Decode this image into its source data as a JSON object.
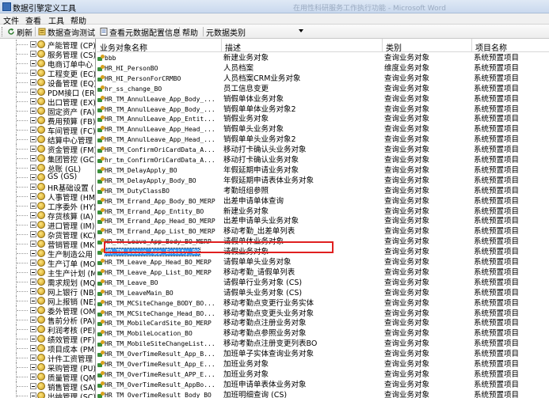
{
  "window": {
    "title": "数据引擎定义工具",
    "ghost_title": "在用性科研服务工作执行功能 - Microsoft Word"
  },
  "menu": [
    "文件",
    "查看",
    "工具",
    "帮助"
  ],
  "toolbar": {
    "refresh": "刷新",
    "query_test": "数据查询测试",
    "view_config": "查看元数据配置信息",
    "help": "帮助",
    "category_label": "元数据类别"
  },
  "tree": {
    "items": [
      "产能管理 (CP)",
      "服务管理 (CS)",
      "电商订单中心",
      "工程变更 (EC)",
      "设备管理 (EQ)",
      "PDM接口 (ER)",
      "出口管理 (EX)",
      "固定资产 (FA)",
      "费用预算 (FB)",
      "车间管理 (FC)",
      "结算中心管理",
      "资金管理 (FM)",
      "集团管控 (GC)",
      "总账 (GL)",
      "GS (GS)",
      "HR基础设置 (",
      "人事管理 (HM)",
      "工序委外 (HY)",
      "存货核算 (IA)",
      "进口管理 (IM)",
      "杂货管理 (KC)",
      "营销管理 (MK)",
      "生产制造公用",
      "生产订单 (MO)",
      "主生产计划 (M",
      "需求规划 (MQ)",
      "网上银行 (NB)",
      "网上报销 (NE)",
      "委外管理 (OM)",
      "售前分析 (PA)",
      "利润考核 (PE)",
      "绩效管理 (PF)",
      "项目成本 (PM)",
      "计件工资管理",
      "采购管理 (PU)",
      "质量管理 (QM)",
      "销售管理 (SA)",
      "出纳管理 (SC)"
    ]
  },
  "list": {
    "columns": [
      "业务对象名称",
      "描述",
      "类别",
      "项目名称"
    ],
    "rows": [
      {
        "name": "bbb",
        "desc": "新建业务对象",
        "cat": "查询业务对象",
        "proj": "系统预置项目"
      },
      {
        "name": "HR_HI_PersonBO",
        "desc": "人员档案",
        "cat": "维度业务对象",
        "proj": "系统预置项目"
      },
      {
        "name": "HR_HI_PersonForCRMBO",
        "desc": "人员档案CRM业务对象",
        "cat": "查询业务对象",
        "proj": "系统预置项目"
      },
      {
        "name": "hr_ss_change_BO",
        "desc": "员工信息变更",
        "cat": "查询业务对象",
        "proj": "系统预置项目"
      },
      {
        "name": "HR_TM_AnnulLeave_App_Body_...",
        "desc": "销假单体业务对象",
        "cat": "查询业务对象",
        "proj": "系统预置项目"
      },
      {
        "name": "HR_TM_AnnulLeave_App_Body_...",
        "desc": "销假单单体业务对象2",
        "cat": "查询业务对象",
        "proj": "系统预置项目"
      },
      {
        "name": "HR_TM_AnnulLeave_App_Entit...",
        "desc": "销假业务对象",
        "cat": "查询业务对象",
        "proj": "系统预置项目"
      },
      {
        "name": "HR_TM_AnnulLeave_App_Head_...",
        "desc": "销假单头业务对象",
        "cat": "查询业务对象",
        "proj": "系统预置项目"
      },
      {
        "name": "HR_TM_AnnulLeave_App_Head_...",
        "desc": "销假单单头业务对象2",
        "cat": "查询业务对象",
        "proj": "系统预置项目"
      },
      {
        "name": "HR_TM_ConfirmOriCardData_A...",
        "desc": "移动打卡确认头业务对象",
        "cat": "查询业务对象",
        "proj": "系统预置项目"
      },
      {
        "name": "hr_tm_ConfirmOriCardData_A...",
        "desc": "移动打卡确认业务对象",
        "cat": "查询业务对象",
        "proj": "系统预置项目"
      },
      {
        "name": "HR_TM_DelayApply_BO",
        "desc": "年假延期申请业务对象",
        "cat": "查询业务对象",
        "proj": "系统预置项目"
      },
      {
        "name": "HR_TM_DelayApply_Body_BO",
        "desc": "年假延期申请表体业务对象",
        "cat": "查询业务对象",
        "proj": "系统预置项目"
      },
      {
        "name": "HR_TM_DutyClassBO",
        "desc": "考勤班组参照",
        "cat": "查询业务对象",
        "proj": "系统预置项目"
      },
      {
        "name": "HR_TM_Errand_App_Body_BO_MERP",
        "desc": "出差申请单体查询",
        "cat": "查询业务对象",
        "proj": "系统预置项目"
      },
      {
        "name": "HR_TM_Errand_App_Entity_BO",
        "desc": "新建业务对象",
        "cat": "查询业务对象",
        "proj": "系统预置项目"
      },
      {
        "name": "HR_TM_Errand_App_Head_BO_MERP",
        "desc": "出差申请单头业务对象",
        "cat": "查询业务对象",
        "proj": "系统预置项目"
      },
      {
        "name": "HR_TM_Errand_App_List_BO_MERP",
        "desc": "移动考勤_出差单列表",
        "cat": "查询业务对象",
        "proj": "系统预置项目"
      },
      {
        "name": "HR_TM_Leave_App_Body_BO_MERP",
        "desc": "请假单体业务对象",
        "cat": "查询业务对象",
        "proj": "系统预置项目"
      },
      {
        "name": "HR_TM_Leave_App_Entity_BO",
        "desc": "请假业务对象",
        "cat": "查询业务对象",
        "proj": "系统预置项目",
        "selected": true
      },
      {
        "name": "HR_TM_Leave_App_Head_BO_MERP",
        "desc": "请假单单头业务对象",
        "cat": "查询业务对象",
        "proj": "系统预置项目"
      },
      {
        "name": "HR_TM_Leave_App_List_BO_MERP",
        "desc": "移动考勤_请假单列表",
        "cat": "查询业务对象",
        "proj": "系统预置项目"
      },
      {
        "name": "HR_TM_Leave_BO",
        "desc": "请假单行业务对象 (CS)",
        "cat": "查询业务对象",
        "proj": "系统预置项目"
      },
      {
        "name": "HR_TM_LeaveMain_BO",
        "desc": "请假单头业务对象 (CS)",
        "cat": "查询业务对象",
        "proj": "系统预置项目"
      },
      {
        "name": "HR_TM_MCSiteChange_BODY_BO...",
        "desc": "移动考勤点变更行业务实体",
        "cat": "查询业务对象",
        "proj": "系统预置项目"
      },
      {
        "name": "HR_TM_MCSiteChange_Head_BO...",
        "desc": "移动考勤点变更头业务对象",
        "cat": "查询业务对象",
        "proj": "系统预置项目"
      },
      {
        "name": "HR_TM_MobileCardSite_BO_MERP",
        "desc": "移动考勤点注册业务对象",
        "cat": "查询业务对象",
        "proj": "系统预置项目"
      },
      {
        "name": "HR_TM_MobileLocation_BO",
        "desc": "移动考勤点参照业务对象",
        "cat": "查询业务对象",
        "proj": "系统预置项目"
      },
      {
        "name": "HR_TM_MobileSiteChangeList...",
        "desc": "移动考勤点注册变更列表BO",
        "cat": "查询业务对象",
        "proj": "系统预置项目"
      },
      {
        "name": "HR_TM_OverTimeResult_App_B...",
        "desc": "加班单子实体查询业务对象",
        "cat": "查询业务对象",
        "proj": "系统预置项目"
      },
      {
        "name": "HR_TM_OverTimeResult_App_E...",
        "desc": "加班业务对象",
        "cat": "查询业务对象",
        "proj": "系统预置项目"
      },
      {
        "name": "HR_TM_OverTimeResult_APP_E...",
        "desc": "加班业务对象",
        "cat": "查询业务对象",
        "proj": "系统预置项目"
      },
      {
        "name": "HR_TM_OverTimeResult_AppBo...",
        "desc": "加班申请单表体业务对象",
        "cat": "查询业务对象",
        "proj": "系统预置项目"
      },
      {
        "name": "HR_TM_OverTimeResult_Body_BO",
        "desc": "加班明细查询 (CS)",
        "cat": "查询业务对象",
        "proj": "系统预置项目"
      },
      {
        "name": "HR_TM_OverTimeToRest_App_K...",
        "desc": "新建业务对象",
        "cat": "查询业务对象",
        "proj": "系统预置项目"
      }
    ]
  },
  "colors": {
    "selection": "#3399ff",
    "highlight": "#e02020"
  }
}
